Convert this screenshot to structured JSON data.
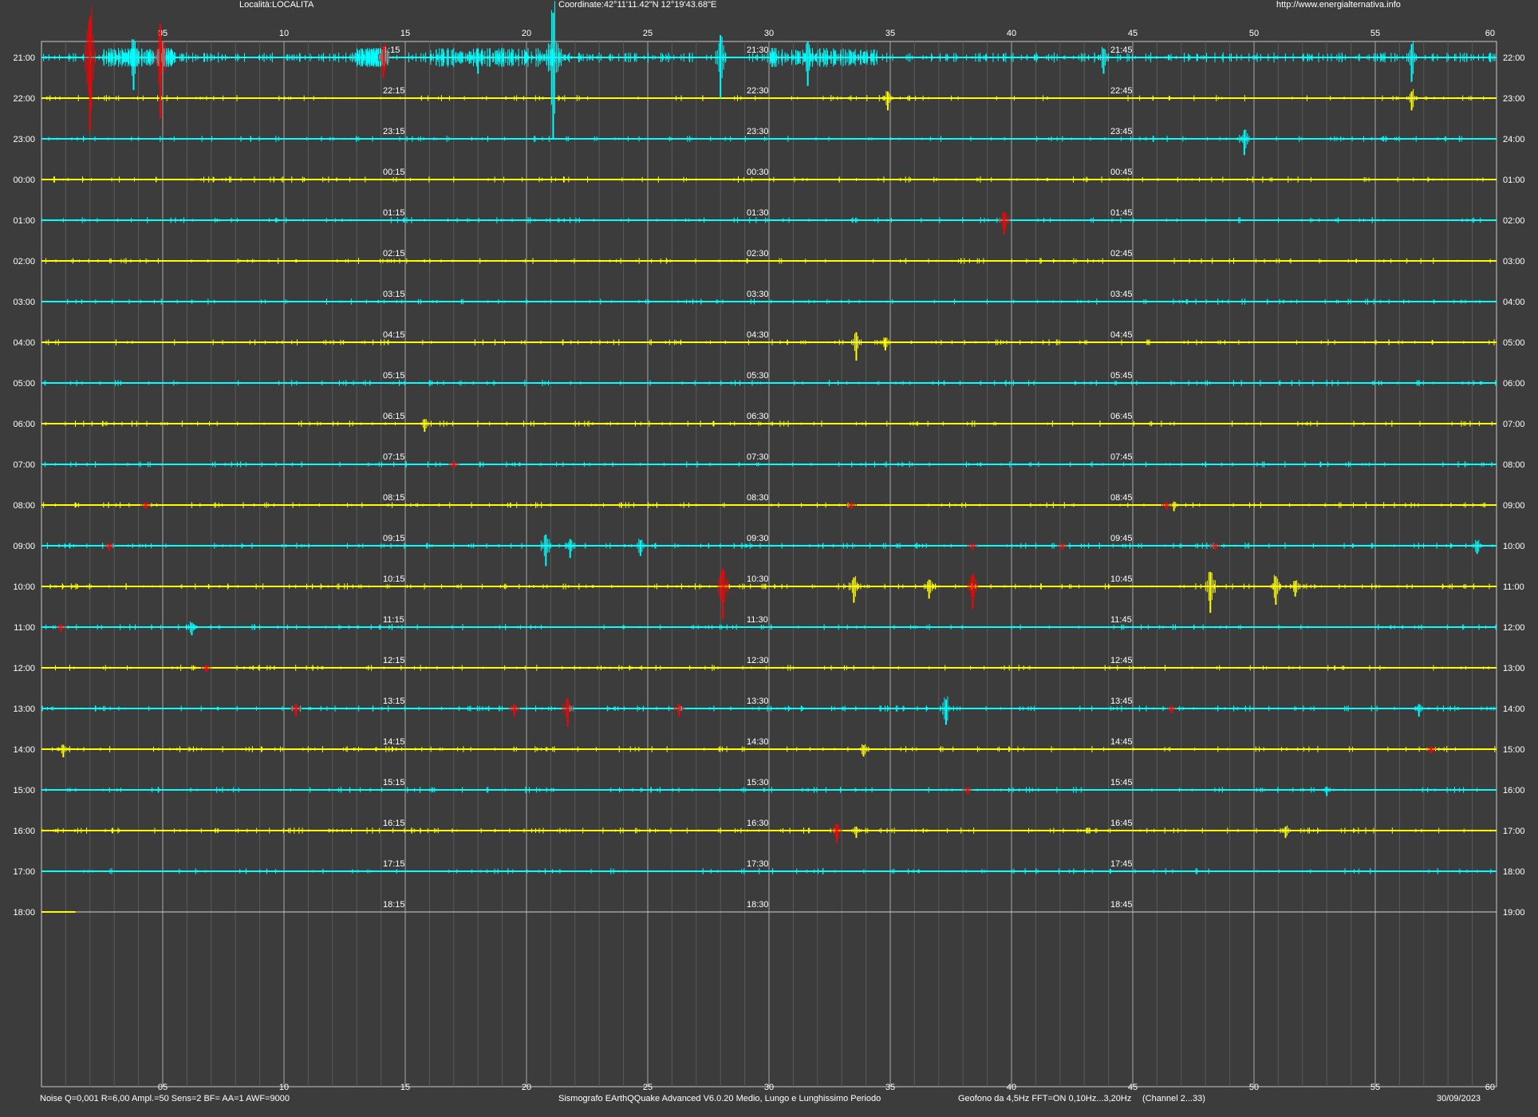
{
  "header": {
    "location": "Località:LOCALITA",
    "coordinates": "Coordinate:42°11'11.42\"N  12°19'43.68\"E",
    "website": "http://www.energialternativa.info"
  },
  "footer": {
    "params": "Noise Q=0,001 R=6,00 Ampl.=50 Sens=2 BF= AA=1 AWF=9000",
    "software": "Sismografo  EArthQQuake Advanced V6.0.20  Medio, Lungo e Lunghissimo Periodo",
    "geophone": "Geofono da 4,5Hz FFT=ON 0,10Hz...3,20Hz",
    "channel": "(Channel 2...33)",
    "date": "30/09/2023"
  },
  "chart_data": {
    "type": "line",
    "subtype": "helicorder",
    "title": "",
    "x": {
      "min": 0,
      "max": 60,
      "unit": "min",
      "ticks": [
        "05",
        "10",
        "15",
        "20",
        "25",
        "30",
        "35",
        "40",
        "45",
        "50",
        "55",
        "60"
      ],
      "grid": true
    },
    "colors": {
      "background": "#3c3c3c",
      "grid": "#a0a0a0",
      "cyan_trace": "#00ffff",
      "yellow_trace": "#ffff00",
      "event": "#ff0000",
      "text": "#ffffff"
    },
    "rows": [
      {
        "left": "21:00",
        "right": "22:00",
        "marks": [
          "1:15",
          "21:30",
          "21:45"
        ],
        "color": "cyan",
        "activity": 3
      },
      {
        "left": "22:00",
        "right": "23:00",
        "marks": [
          "22:15",
          "22:30",
          "22:45"
        ],
        "color": "yellow",
        "activity": 1
      },
      {
        "left": "23:00",
        "right": "24:00",
        "marks": [
          "23:15",
          "23:30",
          "23:45"
        ],
        "color": "cyan",
        "activity": 1
      },
      {
        "left": "00:00",
        "right": "01:00",
        "marks": [
          "00:15",
          "00:30",
          "00:45"
        ],
        "color": "yellow",
        "activity": 1
      },
      {
        "left": "01:00",
        "right": "02:00",
        "marks": [
          "01:15",
          "01:30",
          "01:45"
        ],
        "color": "cyan",
        "activity": 1
      },
      {
        "left": "02:00",
        "right": "03:00",
        "marks": [
          "02:15",
          "02:30",
          "02:45"
        ],
        "color": "yellow",
        "activity": 1
      },
      {
        "left": "03:00",
        "right": "04:00",
        "marks": [
          "03:15",
          "03:30",
          "03:45"
        ],
        "color": "cyan",
        "activity": 1
      },
      {
        "left": "04:00",
        "right": "05:00",
        "marks": [
          "04:15",
          "04:30",
          "04:45"
        ],
        "color": "yellow",
        "activity": 1
      },
      {
        "left": "05:00",
        "right": "06:00",
        "marks": [
          "05:15",
          "05:30",
          "05:45"
        ],
        "color": "cyan",
        "activity": 1
      },
      {
        "left": "06:00",
        "right": "07:00",
        "marks": [
          "06:15",
          "06:30",
          "06:45"
        ],
        "color": "yellow",
        "activity": 1
      },
      {
        "left": "07:00",
        "right": "08:00",
        "marks": [
          "07:15",
          "07:30",
          "07:45"
        ],
        "color": "cyan",
        "activity": 1
      },
      {
        "left": "08:00",
        "right": "09:00",
        "marks": [
          "08:15",
          "08:30",
          "08:45"
        ],
        "color": "yellow",
        "activity": 1
      },
      {
        "left": "09:00",
        "right": "10:00",
        "marks": [
          "09:15",
          "09:30",
          "09:45"
        ],
        "color": "cyan",
        "activity": 1.3
      },
      {
        "left": "10:00",
        "right": "11:00",
        "marks": [
          "10:15",
          "10:30",
          "10:45"
        ],
        "color": "yellow",
        "activity": 1.5
      },
      {
        "left": "11:00",
        "right": "12:00",
        "marks": [
          "11:15",
          "11:30",
          "11:45"
        ],
        "color": "cyan",
        "activity": 1
      },
      {
        "left": "12:00",
        "right": "13:00",
        "marks": [
          "12:15",
          "12:30",
          "12:45"
        ],
        "color": "yellow",
        "activity": 1
      },
      {
        "left": "13:00",
        "right": "14:00",
        "marks": [
          "13:15",
          "13:30",
          "13:45"
        ],
        "color": "cyan",
        "activity": 1.4
      },
      {
        "left": "14:00",
        "right": "15:00",
        "marks": [
          "14:15",
          "14:30",
          "14:45"
        ],
        "color": "yellow",
        "activity": 1.1
      },
      {
        "left": "15:00",
        "right": "16:00",
        "marks": [
          "15:15",
          "15:30",
          "15:45"
        ],
        "color": "cyan",
        "activity": 1
      },
      {
        "left": "16:00",
        "right": "17:00",
        "marks": [
          "16:15",
          "16:30",
          "16:45"
        ],
        "color": "yellow",
        "activity": 1.4
      },
      {
        "left": "17:00",
        "right": "18:00",
        "marks": [
          "17:15",
          "17:30",
          "17:45"
        ],
        "color": "cyan",
        "activity": 0.8
      },
      {
        "left": "18:00",
        "right": "19:00",
        "marks": [
          "18:15",
          "18:30",
          "18:45"
        ],
        "color": "yellow",
        "activity": 0,
        "recorded_until_min": 1.4
      }
    ],
    "events": [
      {
        "row": 0,
        "minute": 2.0,
        "amp": 1.8,
        "color": "red"
      },
      {
        "row": 0,
        "minute": 4.9,
        "amp": 1.5,
        "color": "red"
      },
      {
        "row": 0,
        "minute": 14.1,
        "amp": 0.5,
        "color": "red"
      },
      {
        "row": 0,
        "minute": 3.8,
        "amp": 0.8,
        "color": "cyan"
      },
      {
        "row": 0,
        "minute": 18.0,
        "amp": 0.4,
        "color": "cyan"
      },
      {
        "row": 0,
        "minute": 21.1,
        "amp": 2.0,
        "color": "cyan"
      },
      {
        "row": 0,
        "minute": 28.0,
        "amp": 1.0,
        "color": "cyan"
      },
      {
        "row": 0,
        "minute": 31.6,
        "amp": 0.7,
        "color": "cyan"
      },
      {
        "row": 0,
        "minute": 43.8,
        "amp": 0.4,
        "color": "cyan"
      },
      {
        "row": 0,
        "minute": 56.5,
        "amp": 0.6,
        "color": "cyan"
      },
      {
        "row": 1,
        "minute": 34.9,
        "amp": 0.3,
        "color": "yellow"
      },
      {
        "row": 1,
        "minute": 56.5,
        "amp": 0.3,
        "color": "yellow"
      },
      {
        "row": 2,
        "minute": 49.6,
        "amp": 0.4,
        "color": "cyan"
      },
      {
        "row": 4,
        "minute": 39.7,
        "amp": 0.35,
        "color": "red"
      },
      {
        "row": 7,
        "minute": 33.6,
        "amp": 0.45,
        "color": "yellow"
      },
      {
        "row": 7,
        "minute": 34.8,
        "amp": 0.2,
        "color": "yellow"
      },
      {
        "row": 9,
        "minute": 15.8,
        "amp": 0.2,
        "color": "yellow"
      },
      {
        "row": 10,
        "minute": 17.0,
        "amp": 0.1,
        "color": "red"
      },
      {
        "row": 11,
        "minute": 4.3,
        "amp": 0.1,
        "color": "red"
      },
      {
        "row": 11,
        "minute": 33.4,
        "amp": 0.1,
        "color": "red"
      },
      {
        "row": 11,
        "minute": 46.4,
        "amp": 0.12,
        "color": "red"
      },
      {
        "row": 11,
        "minute": 46.7,
        "amp": 0.15,
        "color": "yellow"
      },
      {
        "row": 12,
        "minute": 2.8,
        "amp": 0.12,
        "color": "red"
      },
      {
        "row": 12,
        "minute": 20.8,
        "amp": 0.5,
        "color": "cyan"
      },
      {
        "row": 12,
        "minute": 21.8,
        "amp": 0.3,
        "color": "cyan"
      },
      {
        "row": 12,
        "minute": 24.7,
        "amp": 0.25,
        "color": "cyan"
      },
      {
        "row": 12,
        "minute": 38.4,
        "amp": 0.1,
        "color": "red"
      },
      {
        "row": 12,
        "minute": 42.1,
        "amp": 0.1,
        "color": "red"
      },
      {
        "row": 12,
        "minute": 48.4,
        "amp": 0.1,
        "color": "red"
      },
      {
        "row": 12,
        "minute": 59.2,
        "amp": 0.2,
        "color": "cyan"
      },
      {
        "row": 13,
        "minute": 28.1,
        "amp": 0.8,
        "color": "red"
      },
      {
        "row": 13,
        "minute": 33.5,
        "amp": 0.4,
        "color": "yellow"
      },
      {
        "row": 13,
        "minute": 36.6,
        "amp": 0.3,
        "color": "yellow"
      },
      {
        "row": 13,
        "minute": 38.4,
        "amp": 0.55,
        "color": "red"
      },
      {
        "row": 13,
        "minute": 48.2,
        "amp": 0.65,
        "color": "yellow"
      },
      {
        "row": 13,
        "minute": 50.9,
        "amp": 0.45,
        "color": "yellow"
      },
      {
        "row": 13,
        "minute": 51.7,
        "amp": 0.25,
        "color": "yellow"
      },
      {
        "row": 14,
        "minute": 0.8,
        "amp": 0.12,
        "color": "red"
      },
      {
        "row": 14,
        "minute": 6.2,
        "amp": 0.2,
        "color": "cyan"
      },
      {
        "row": 15,
        "minute": 6.8,
        "amp": 0.1,
        "color": "red"
      },
      {
        "row": 16,
        "minute": 10.5,
        "amp": 0.2,
        "color": "red"
      },
      {
        "row": 16,
        "minute": 19.5,
        "amp": 0.2,
        "color": "red"
      },
      {
        "row": 16,
        "minute": 21.7,
        "amp": 0.45,
        "color": "red"
      },
      {
        "row": 16,
        "minute": 26.3,
        "amp": 0.2,
        "color": "red"
      },
      {
        "row": 16,
        "minute": 37.3,
        "amp": 0.4,
        "color": "cyan"
      },
      {
        "row": 16,
        "minute": 46.6,
        "amp": 0.12,
        "color": "red"
      },
      {
        "row": 16,
        "minute": 56.8,
        "amp": 0.2,
        "color": "cyan"
      },
      {
        "row": 17,
        "minute": 0.9,
        "amp": 0.2,
        "color": "yellow"
      },
      {
        "row": 17,
        "minute": 33.9,
        "amp": 0.18,
        "color": "yellow"
      },
      {
        "row": 17,
        "minute": 57.3,
        "amp": 0.1,
        "color": "red"
      },
      {
        "row": 18,
        "minute": 38.2,
        "amp": 0.1,
        "color": "red"
      },
      {
        "row": 18,
        "minute": 53.0,
        "amp": 0.15,
        "color": "cyan"
      },
      {
        "row": 19,
        "minute": 32.8,
        "amp": 0.3,
        "color": "red"
      },
      {
        "row": 19,
        "minute": 33.6,
        "amp": 0.18,
        "color": "yellow"
      },
      {
        "row": 19,
        "minute": 51.3,
        "amp": 0.18,
        "color": "yellow"
      }
    ]
  }
}
